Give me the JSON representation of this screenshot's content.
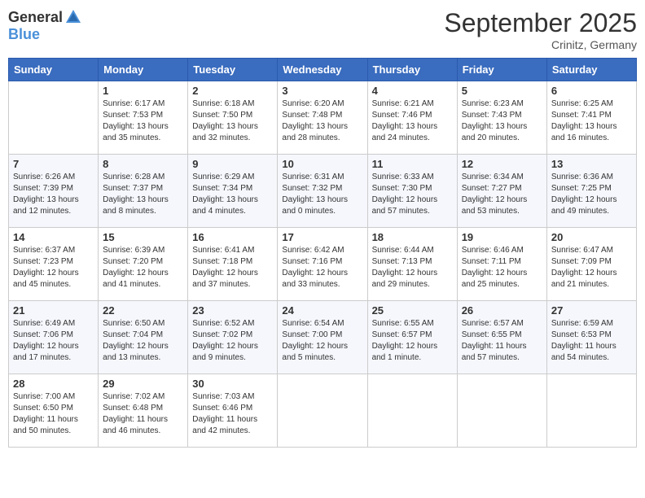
{
  "header": {
    "logo_general": "General",
    "logo_blue": "Blue",
    "month_title": "September 2025",
    "subtitle": "Crinitz, Germany"
  },
  "days_of_week": [
    "Sunday",
    "Monday",
    "Tuesday",
    "Wednesday",
    "Thursday",
    "Friday",
    "Saturday"
  ],
  "weeks": [
    [
      {
        "num": "",
        "info": ""
      },
      {
        "num": "1",
        "info": "Sunrise: 6:17 AM\nSunset: 7:53 PM\nDaylight: 13 hours\nand 35 minutes."
      },
      {
        "num": "2",
        "info": "Sunrise: 6:18 AM\nSunset: 7:50 PM\nDaylight: 13 hours\nand 32 minutes."
      },
      {
        "num": "3",
        "info": "Sunrise: 6:20 AM\nSunset: 7:48 PM\nDaylight: 13 hours\nand 28 minutes."
      },
      {
        "num": "4",
        "info": "Sunrise: 6:21 AM\nSunset: 7:46 PM\nDaylight: 13 hours\nand 24 minutes."
      },
      {
        "num": "5",
        "info": "Sunrise: 6:23 AM\nSunset: 7:43 PM\nDaylight: 13 hours\nand 20 minutes."
      },
      {
        "num": "6",
        "info": "Sunrise: 6:25 AM\nSunset: 7:41 PM\nDaylight: 13 hours\nand 16 minutes."
      }
    ],
    [
      {
        "num": "7",
        "info": "Sunrise: 6:26 AM\nSunset: 7:39 PM\nDaylight: 13 hours\nand 12 minutes."
      },
      {
        "num": "8",
        "info": "Sunrise: 6:28 AM\nSunset: 7:37 PM\nDaylight: 13 hours\nand 8 minutes."
      },
      {
        "num": "9",
        "info": "Sunrise: 6:29 AM\nSunset: 7:34 PM\nDaylight: 13 hours\nand 4 minutes."
      },
      {
        "num": "10",
        "info": "Sunrise: 6:31 AM\nSunset: 7:32 PM\nDaylight: 13 hours\nand 0 minutes."
      },
      {
        "num": "11",
        "info": "Sunrise: 6:33 AM\nSunset: 7:30 PM\nDaylight: 12 hours\nand 57 minutes."
      },
      {
        "num": "12",
        "info": "Sunrise: 6:34 AM\nSunset: 7:27 PM\nDaylight: 12 hours\nand 53 minutes."
      },
      {
        "num": "13",
        "info": "Sunrise: 6:36 AM\nSunset: 7:25 PM\nDaylight: 12 hours\nand 49 minutes."
      }
    ],
    [
      {
        "num": "14",
        "info": "Sunrise: 6:37 AM\nSunset: 7:23 PM\nDaylight: 12 hours\nand 45 minutes."
      },
      {
        "num": "15",
        "info": "Sunrise: 6:39 AM\nSunset: 7:20 PM\nDaylight: 12 hours\nand 41 minutes."
      },
      {
        "num": "16",
        "info": "Sunrise: 6:41 AM\nSunset: 7:18 PM\nDaylight: 12 hours\nand 37 minutes."
      },
      {
        "num": "17",
        "info": "Sunrise: 6:42 AM\nSunset: 7:16 PM\nDaylight: 12 hours\nand 33 minutes."
      },
      {
        "num": "18",
        "info": "Sunrise: 6:44 AM\nSunset: 7:13 PM\nDaylight: 12 hours\nand 29 minutes."
      },
      {
        "num": "19",
        "info": "Sunrise: 6:46 AM\nSunset: 7:11 PM\nDaylight: 12 hours\nand 25 minutes."
      },
      {
        "num": "20",
        "info": "Sunrise: 6:47 AM\nSunset: 7:09 PM\nDaylight: 12 hours\nand 21 minutes."
      }
    ],
    [
      {
        "num": "21",
        "info": "Sunrise: 6:49 AM\nSunset: 7:06 PM\nDaylight: 12 hours\nand 17 minutes."
      },
      {
        "num": "22",
        "info": "Sunrise: 6:50 AM\nSunset: 7:04 PM\nDaylight: 12 hours\nand 13 minutes."
      },
      {
        "num": "23",
        "info": "Sunrise: 6:52 AM\nSunset: 7:02 PM\nDaylight: 12 hours\nand 9 minutes."
      },
      {
        "num": "24",
        "info": "Sunrise: 6:54 AM\nSunset: 7:00 PM\nDaylight: 12 hours\nand 5 minutes."
      },
      {
        "num": "25",
        "info": "Sunrise: 6:55 AM\nSunset: 6:57 PM\nDaylight: 12 hours\nand 1 minute."
      },
      {
        "num": "26",
        "info": "Sunrise: 6:57 AM\nSunset: 6:55 PM\nDaylight: 11 hours\nand 57 minutes."
      },
      {
        "num": "27",
        "info": "Sunrise: 6:59 AM\nSunset: 6:53 PM\nDaylight: 11 hours\nand 54 minutes."
      }
    ],
    [
      {
        "num": "28",
        "info": "Sunrise: 7:00 AM\nSunset: 6:50 PM\nDaylight: 11 hours\nand 50 minutes."
      },
      {
        "num": "29",
        "info": "Sunrise: 7:02 AM\nSunset: 6:48 PM\nDaylight: 11 hours\nand 46 minutes."
      },
      {
        "num": "30",
        "info": "Sunrise: 7:03 AM\nSunset: 6:46 PM\nDaylight: 11 hours\nand 42 minutes."
      },
      {
        "num": "",
        "info": ""
      },
      {
        "num": "",
        "info": ""
      },
      {
        "num": "",
        "info": ""
      },
      {
        "num": "",
        "info": ""
      }
    ]
  ]
}
